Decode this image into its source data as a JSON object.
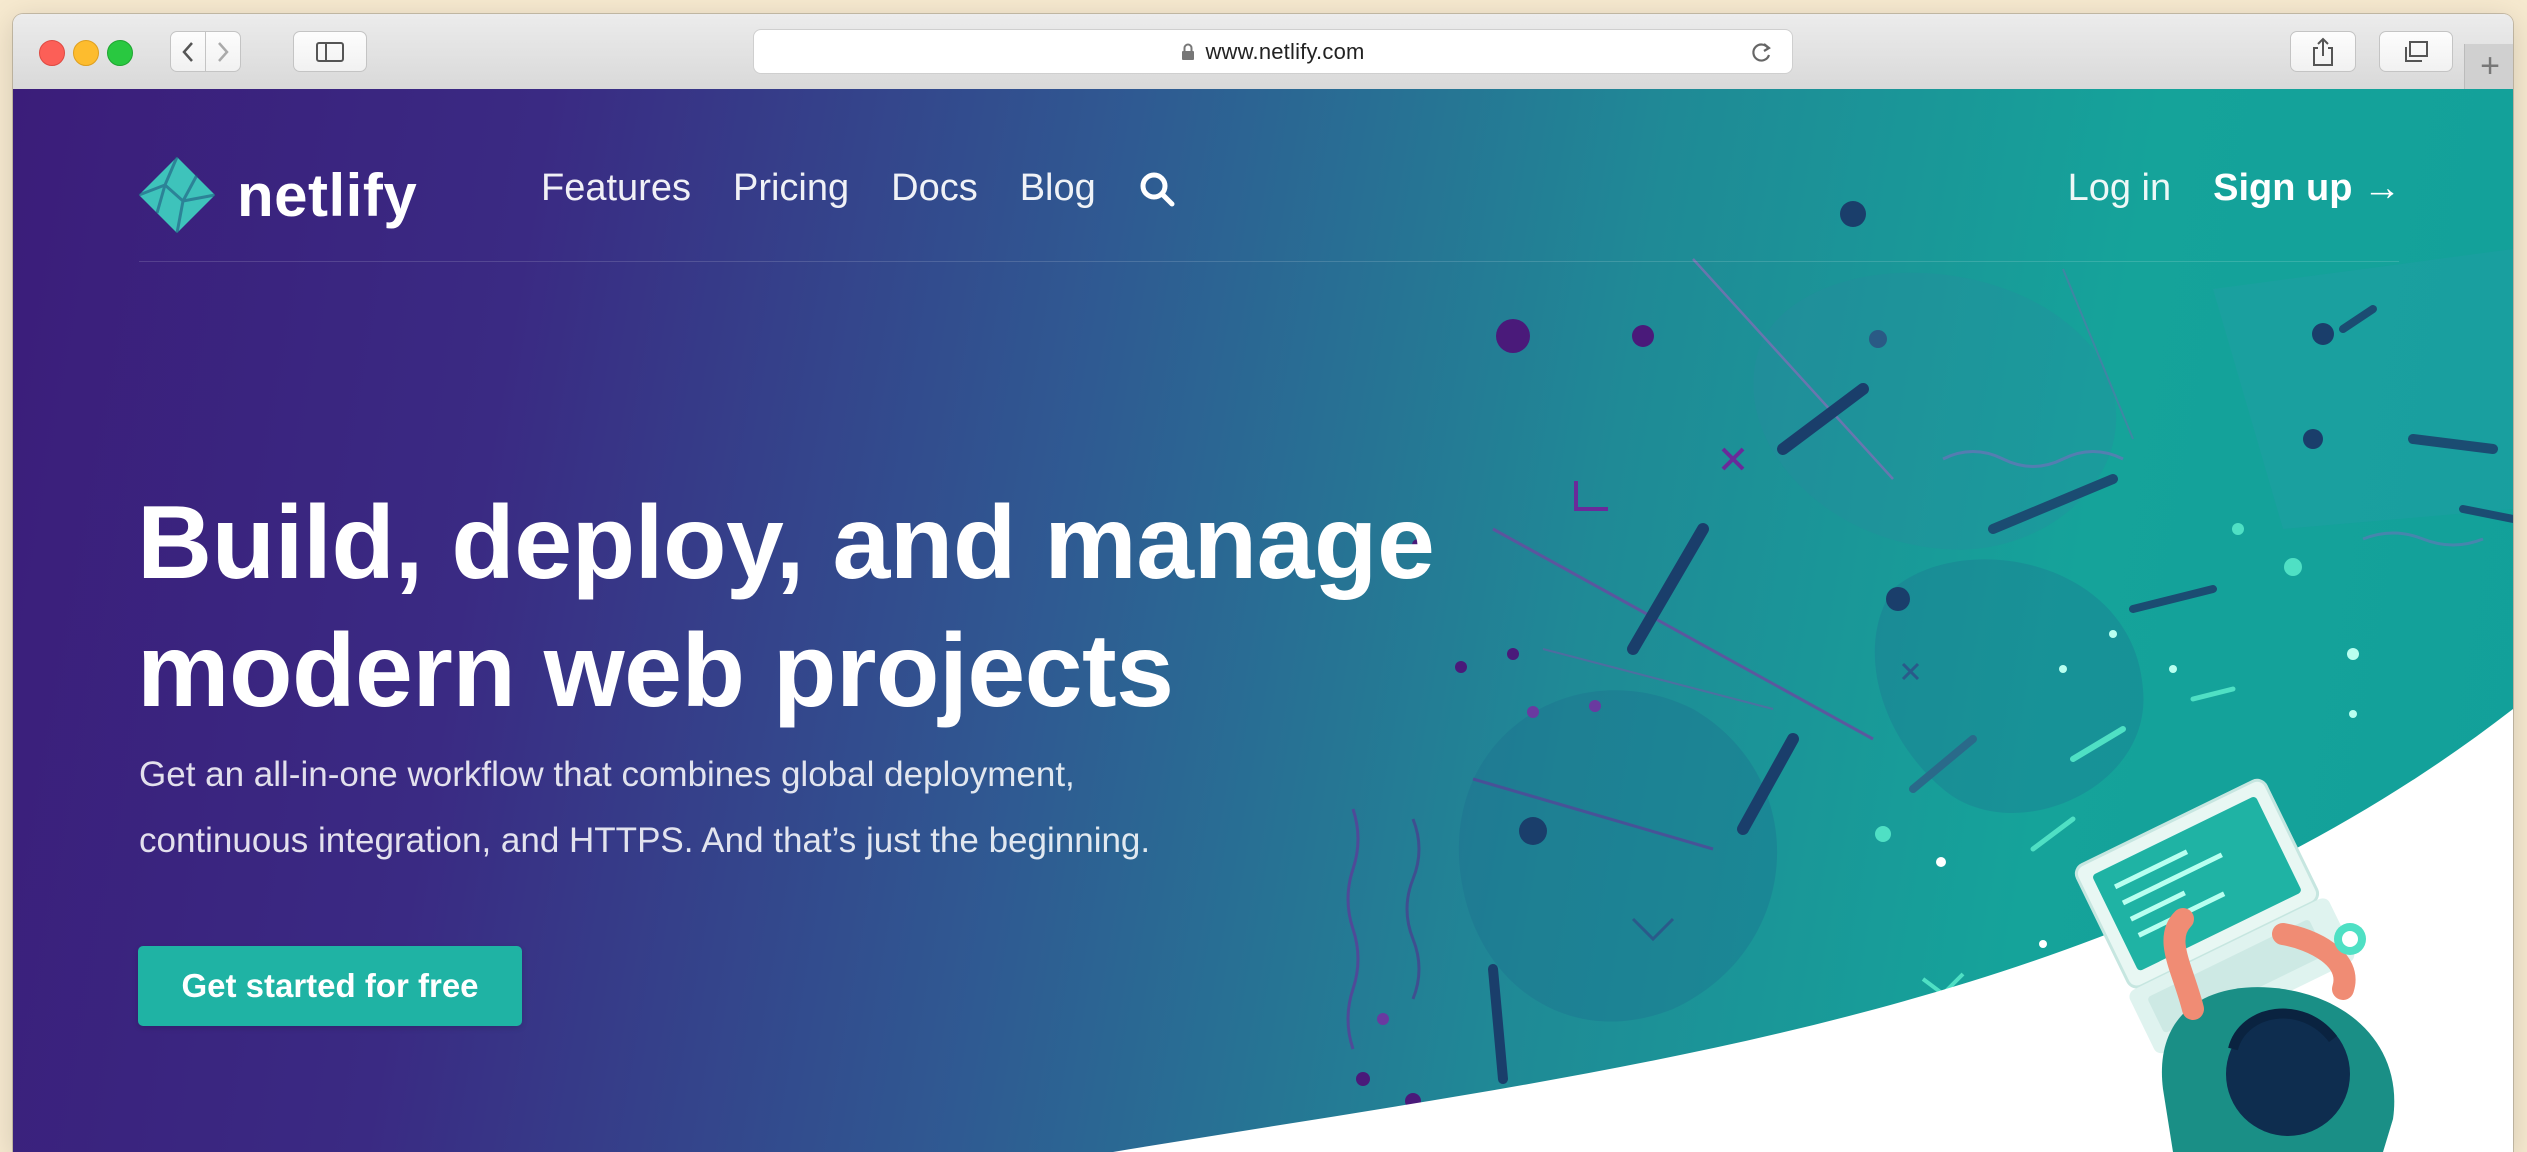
{
  "browser": {
    "url": "www.netlify.com"
  },
  "brand": {
    "name": "netlify"
  },
  "nav": {
    "items": [
      "Features",
      "Pricing",
      "Docs",
      "Blog"
    ],
    "login": "Log in",
    "signup": "Sign up →"
  },
  "hero": {
    "headline_line1": "Build, deploy, and manage",
    "headline_line2": "modern web projects",
    "sub_line1": "Get an all-in-one workflow that combines global deployment,",
    "sub_line2": "continuous integration, and HTTPS. And that’s just the beginning.",
    "cta": "Get started for free"
  },
  "colors": {
    "gradient_start": "#3b1d7a",
    "gradient_end": "#12a09a",
    "accent": "#1fb3a4"
  },
  "icons": [
    "lock-icon",
    "reload-icon",
    "share-icon",
    "tabs-icon",
    "sidebar-icon",
    "back-icon",
    "forward-icon",
    "search-icon",
    "netlify-logo-icon"
  ]
}
